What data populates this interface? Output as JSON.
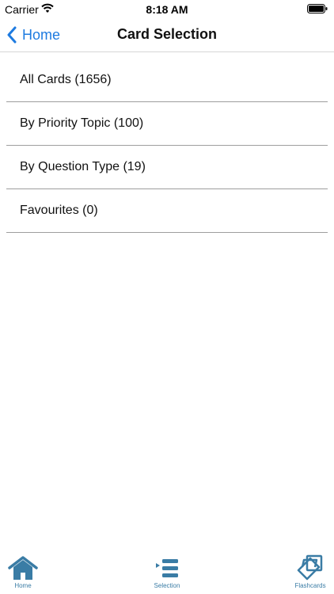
{
  "status_bar": {
    "carrier": "Carrier",
    "time": "8:18 AM"
  },
  "nav": {
    "back_label": "Home",
    "title": "Card Selection"
  },
  "list": {
    "items": [
      {
        "label": "All Cards (1656)"
      },
      {
        "label": "By Priority Topic (100)"
      },
      {
        "label": "By Question Type (19)"
      },
      {
        "label": "Favourites (0)"
      }
    ]
  },
  "tabs": [
    {
      "label": "Home",
      "icon": "home-icon"
    },
    {
      "label": "Selection",
      "icon": "list-selection-icon"
    },
    {
      "label": "Flashcards",
      "icon": "flashcards-icon"
    }
  ],
  "colors": {
    "accent": "#1e7be0",
    "tab_icon": "#3a7ca5"
  }
}
